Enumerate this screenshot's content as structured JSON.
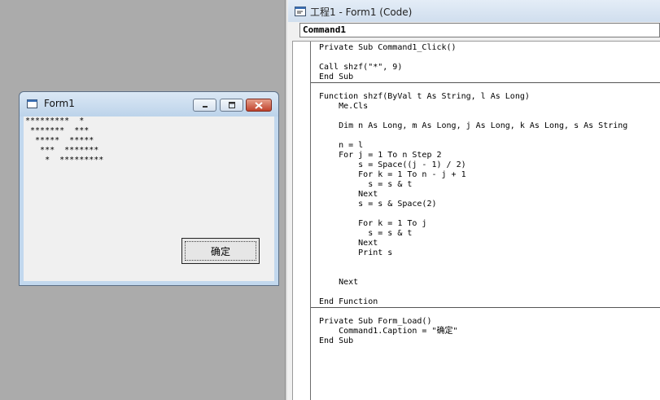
{
  "form1": {
    "title": "Form1",
    "output_lines": [
      "*********  *",
      " *******  ***",
      "  *****  *****",
      "   ***  *******",
      "    *  *********"
    ],
    "ok_button_label": "确定"
  },
  "code_window": {
    "title": "工程1 - Form1 (Code)",
    "object_combo_value": "Command1",
    "lines": [
      {
        "text": "Private Sub Command1_Click()",
        "sep": false
      },
      {
        "text": "",
        "sep": false
      },
      {
        "text": "Call shzf(\"*\", 9)",
        "sep": false
      },
      {
        "text": "End Sub",
        "sep": false
      },
      {
        "text": "",
        "sep": true
      },
      {
        "text": "Function shzf(ByVal t As String, l As Long)",
        "sep": false
      },
      {
        "text": "    Me.Cls",
        "sep": false
      },
      {
        "text": "",
        "sep": false
      },
      {
        "text": "    Dim n As Long, m As Long, j As Long, k As Long, s As String",
        "sep": false
      },
      {
        "text": "",
        "sep": false
      },
      {
        "text": "    n = l",
        "sep": false
      },
      {
        "text": "    For j = 1 To n Step 2",
        "sep": false
      },
      {
        "text": "        s = Space((j - 1) / 2)",
        "sep": false
      },
      {
        "text": "        For k = 1 To n - j + 1",
        "sep": false
      },
      {
        "text": "          s = s & t",
        "sep": false
      },
      {
        "text": "        Next",
        "sep": false
      },
      {
        "text": "        s = s & Space(2)",
        "sep": false
      },
      {
        "text": "",
        "sep": false
      },
      {
        "text": "        For k = 1 To j",
        "sep": false
      },
      {
        "text": "          s = s & t",
        "sep": false
      },
      {
        "text": "        Next",
        "sep": false
      },
      {
        "text": "        Print s",
        "sep": false
      },
      {
        "text": "",
        "sep": false
      },
      {
        "text": "",
        "sep": false
      },
      {
        "text": "    Next",
        "sep": false
      },
      {
        "text": "",
        "sep": false
      },
      {
        "text": "End Function",
        "sep": false
      },
      {
        "text": "",
        "sep": true
      },
      {
        "text": "Private Sub Form_Load()",
        "sep": false
      },
      {
        "text": "    Command1.Caption = \"确定\"",
        "sep": false
      },
      {
        "text": "End Sub",
        "sep": false
      }
    ]
  },
  "icons": {
    "form_icon": "form-icon",
    "code_icon": "code-icon",
    "minimize": "minimize-icon",
    "maximize": "maximize-icon",
    "close": "close-icon"
  },
  "colors": {
    "workspace": "#ababab",
    "close_button": "#c0432d",
    "form_frame": "#c2d8ee"
  }
}
